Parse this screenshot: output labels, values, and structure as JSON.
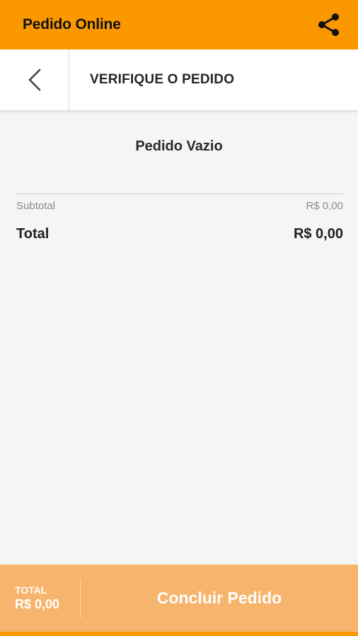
{
  "appbar": {
    "title": "Pedido Online",
    "share_icon": "share-icon"
  },
  "subheader": {
    "back_icon": "chevron-left-icon",
    "title": "VERIFIQUE O PEDIDO"
  },
  "order": {
    "empty_message": "Pedido Vazio",
    "subtotal_label": "Subtotal",
    "subtotal_value": "R$ 0,00",
    "total_label": "Total",
    "total_value": "R$ 0,00"
  },
  "footer": {
    "total_label": "TOTAL",
    "total_value": "R$ 0,00",
    "conclude_label": "Concluir Pedido"
  },
  "colors": {
    "accent": "#fb9800",
    "footer_bg": "#f7b46c",
    "background": "#f5f5f5"
  }
}
